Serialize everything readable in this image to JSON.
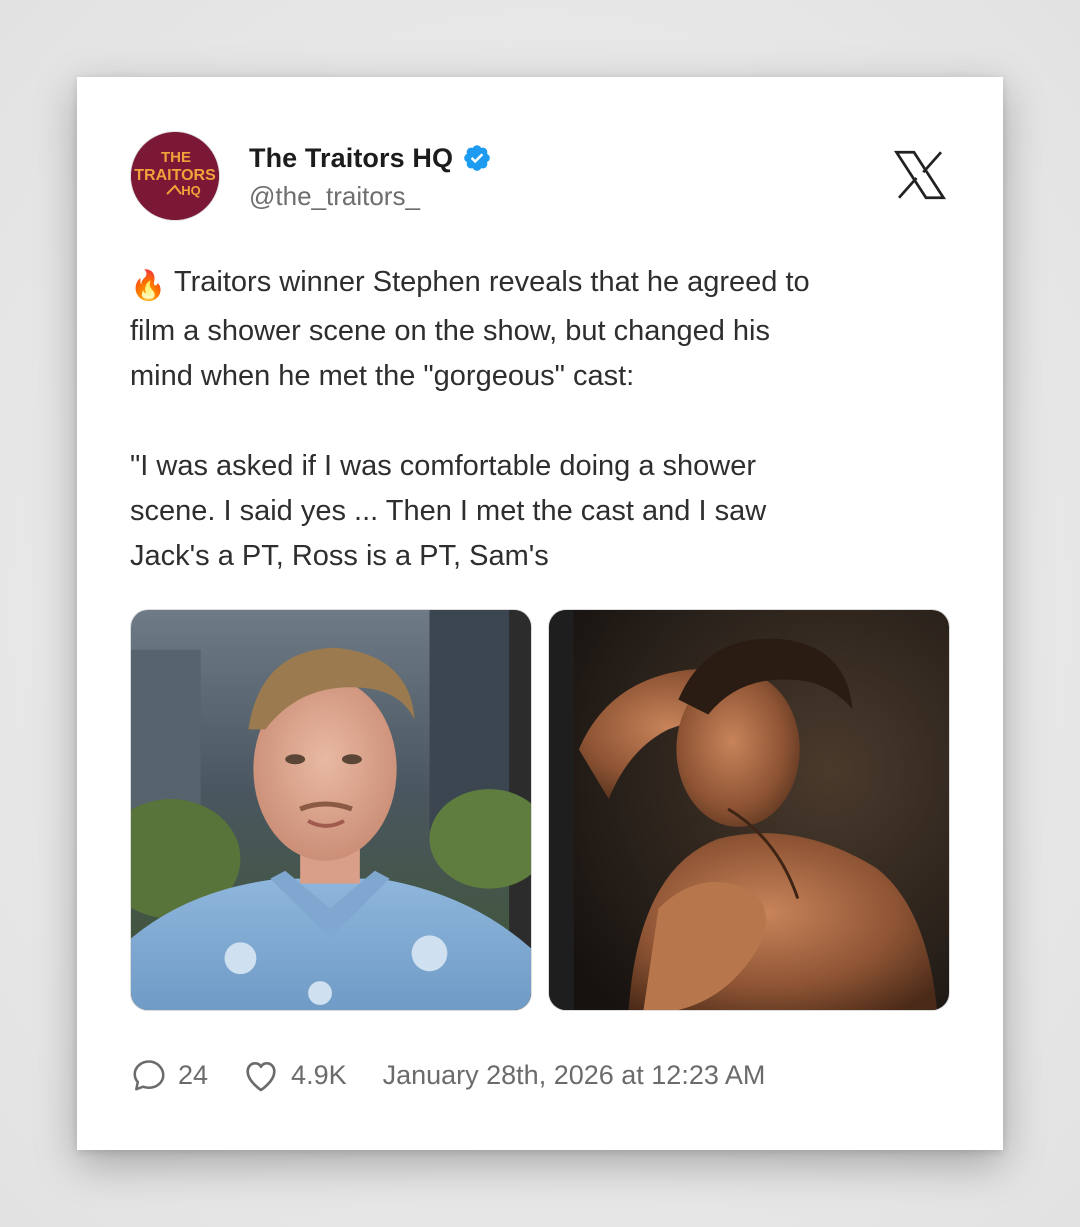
{
  "account": {
    "display_name": "The Traitors HQ",
    "handle": "@the_traitors_",
    "verified": true,
    "avatar_text": [
      "THE",
      "TRAITORS",
      "HQ"
    ]
  },
  "platform_icon": "x-logo-icon",
  "tweet": {
    "emoji": "🔥",
    "text": "Traitors winner Stephen reveals that he agreed to\nfilm a shower scene on the show, but changed his\nmind when he met the \"gorgeous\" cast:\n\n\"I was asked if I was comfortable doing a shower\nscene. I said yes ... Then I met the cast and I saw\nJack's a PT, Ross is a PT, Sam's"
  },
  "media": [
    {
      "icon": "photo-man-in-blue-shirt"
    },
    {
      "icon": "photo-shower-scene"
    }
  ],
  "stats": {
    "replies": "24",
    "likes": "4.9K",
    "timestamp": "January 28th, 2026 at 12:23 AM"
  },
  "colors": {
    "verified_badge": "#1d9bf0",
    "avatar_bg": "#7a1836",
    "avatar_text": "#f2a23a"
  }
}
